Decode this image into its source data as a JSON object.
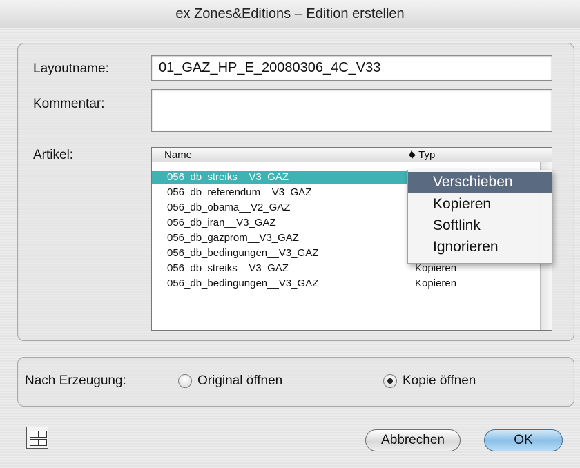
{
  "window": {
    "title": "ex Zones&Editions – Edition erstellen"
  },
  "form": {
    "layoutname_label": "Layoutname:",
    "layoutname_value": "01_GAZ_HP_E_20080306_4C_V33",
    "kommentar_label": "Kommentar:",
    "kommentar_value": "",
    "artikel_label": "Artikel:"
  },
  "list": {
    "col_name": "Name",
    "col_typ": "Typ",
    "rows": [
      {
        "name": "056_db_streiks__V3_GAZ",
        "typ": "",
        "selected": true
      },
      {
        "name": "056_db_referendum__V3_GAZ",
        "typ": ""
      },
      {
        "name": "056_db_obama__V2_GAZ",
        "typ": ""
      },
      {
        "name": "056_db_iran__V3_GAZ",
        "typ": ""
      },
      {
        "name": "056_db_gazprom__V3_GAZ",
        "typ": ""
      },
      {
        "name": "056_db_bedingungen__V3_GAZ",
        "typ": ""
      },
      {
        "name": "056_db_streiks__V3_GAZ",
        "typ": "Kopieren"
      },
      {
        "name": "056_db_bedingungen__V3_GAZ",
        "typ": "Kopieren"
      }
    ]
  },
  "popup": {
    "items": [
      "Verschieben",
      "Kopieren",
      "Softlink",
      "Ignorieren"
    ],
    "highlighted": "Verschieben"
  },
  "after_creation": {
    "label": "Nach Erzeugung:",
    "option_original": "Original öffnen",
    "option_copy": "Kopie öffnen",
    "selected": "Kopie öffnen"
  },
  "buttons": {
    "cancel": "Abbrechen",
    "ok": "OK"
  },
  "icons": {
    "layout": "layout-grid-icon",
    "sort": "sort-arrows-icon"
  }
}
